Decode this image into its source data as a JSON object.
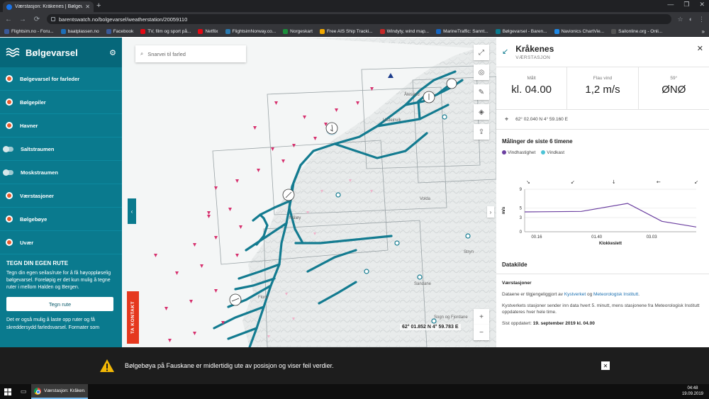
{
  "browser": {
    "tab_title": "Værstasjon: Kråkenes | Bølgevars",
    "url": "barentswatch.no/bolgevarsel/weatherstation/20059110",
    "bookmarks": [
      {
        "label": "Flightsim.no - Foru...",
        "color": "#3b5998"
      },
      {
        "label": "baatplassen.no",
        "color": "#1d6fb8"
      },
      {
        "label": "Facebook",
        "color": "#3b5998"
      },
      {
        "label": "TV, film og sport på...",
        "color": "#e50914"
      },
      {
        "label": "Netflix",
        "color": "#e50914"
      },
      {
        "label": "FlightsimNorway.co...",
        "color": "#2a7ab0"
      },
      {
        "label": "Norgeskart",
        "color": "#1b8f3a"
      },
      {
        "label": "Free AIS Ship Tracki...",
        "color": "#f2a900"
      },
      {
        "label": "Windyty, wind map...",
        "color": "#c62828"
      },
      {
        "label": "MarineTraffic: Sannt...",
        "color": "#1565c0"
      },
      {
        "label": "Bølgevarsel - Baren...",
        "color": "#0a7a8e"
      },
      {
        "label": "Navionics ChartVie...",
        "color": "#1e88e5"
      },
      {
        "label": "Sailonline.org - Onli...",
        "color": "#555555"
      }
    ],
    "bookmarks_more": "»"
  },
  "sidebar": {
    "brand": "Bølgevarsel",
    "items": [
      {
        "label": "Bølgevarsel for farleder",
        "control": "dot"
      },
      {
        "label": "Bølgepiler",
        "control": "dot"
      },
      {
        "label": "Havner",
        "control": "dot"
      },
      {
        "label": "Saltstraumen",
        "control": "toggle"
      },
      {
        "label": "Moskstraumen",
        "control": "toggle"
      },
      {
        "label": "Værstasjoner",
        "control": "dot"
      },
      {
        "label": "Bølgebøye",
        "control": "dot"
      },
      {
        "label": "Uvær",
        "control": "dot"
      }
    ],
    "route": {
      "title": "TEGN DIN EGEN RUTE",
      "text1": "Tegn din egen seilas/rute for å få høyoppløselig bølgevarsel. Foreløpig er det kun mulig å tegne ruter i mellom Halden og Bergen.",
      "button": "Tegn rute",
      "text2": "Det er også mulig å laste opp ruter og få skreddersydd farledsvarsel. Formater som"
    }
  },
  "map": {
    "search_placeholder": "Snarvei til farled",
    "coordinates": "62° 01.852 N 4° 59.783 E",
    "contact_label": "TA KONTAKT",
    "places": [
      "Ålesund",
      "Ulsteinvik",
      "Volda",
      "Måløy",
      "Florø",
      "Stryn",
      "Sandane",
      "Sogn og Fjordane"
    ]
  },
  "panel": {
    "title": "Kråkenes",
    "subtitle": "VÆRSTASJON",
    "stats": [
      {
        "label": "Målt",
        "value": "kl. 04.00"
      },
      {
        "label": "Flau vind",
        "value": "1,2 m/s"
      },
      {
        "label": "59°",
        "value": "ØNØ"
      }
    ],
    "position": "62° 02.040 N 4° 59.160 E",
    "chart_title": "Målinger de siste 6 timene",
    "source_title": "Datakilde",
    "source_subtitle": "Værstasjoner",
    "source_text1_pre": "Dataene er tilgjengeliggjort av ",
    "source_link1": "Kystverket",
    "source_text1_mid": " og ",
    "source_link2": "Meteorologisk Institutt",
    "source_text1_post": ".",
    "source_text2": "Kystverkets stasjoner sender inn data hvert 5. minutt, mens stasjonene fra Meteorologisk Institutt oppdateres hver hele time.",
    "updated_label": "Sist oppdatert: ",
    "updated_value": "19. september 2019 kl. 04.00"
  },
  "chart_data": {
    "type": "line",
    "title": "",
    "xlabel": "Klokkeslett",
    "ylabel": "m/s",
    "x_ticks": [
      "00.16",
      "01.40",
      "03.03"
    ],
    "y_ticks": [
      0,
      3,
      5,
      9
    ],
    "ylim": [
      0,
      9
    ],
    "series": [
      {
        "name": "Vindhastighet",
        "color": "#6b3fa0",
        "x": [
          0.0,
          0.33,
          0.6,
          0.8,
          1.0
        ],
        "y": [
          4.2,
          4.3,
          6.0,
          2.2,
          1.0
        ]
      },
      {
        "name": "Vindkast",
        "color": "#4dc3d6",
        "x": [],
        "y": []
      }
    ],
    "legend_position": "top-left"
  },
  "notice": {
    "text": "Bølgebøya på Fauskane er midlertidig ute av posisjon og viser feil verdier."
  },
  "taskbar": {
    "app_label": "Værstasjon: Kråken...",
    "time": "04:48",
    "date": "19.09.2019"
  },
  "colors": {
    "teal": "#0a7a8e",
    "fairway": "#137b90",
    "arrow": "#d6316e",
    "warning": "#f2b705"
  }
}
